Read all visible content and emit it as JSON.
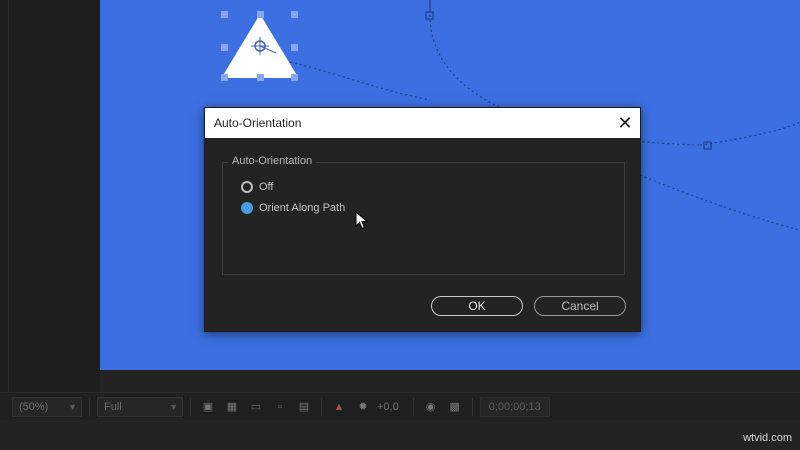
{
  "dialog": {
    "title": "Auto-Orientation",
    "group_label": "Auto-Orientation",
    "options": [
      {
        "label": "Off",
        "selected": false
      },
      {
        "label": "Orient Along Path",
        "selected": true
      }
    ],
    "ok_label": "OK",
    "cancel_label": "Cancel",
    "close_icon": "close-icon"
  },
  "toolbar": {
    "magnification": "(50%)",
    "resolution": "Full",
    "exposure": "+0,0",
    "timecode": "0;00;00;13",
    "icons": [
      "region-of-interest-icon",
      "transparency-grid-icon",
      "mask-visibility-icon",
      "guides-icon",
      "grid-icon",
      "color-channel-icon",
      "exposure-reset-icon",
      "snapshot-icon",
      "show-snapshot-icon"
    ]
  },
  "colors": {
    "composition_bg": "#3c70e2",
    "dialog_bg": "#232323",
    "accent": "#4a9ae8"
  },
  "watermark": "wtvid.com"
}
